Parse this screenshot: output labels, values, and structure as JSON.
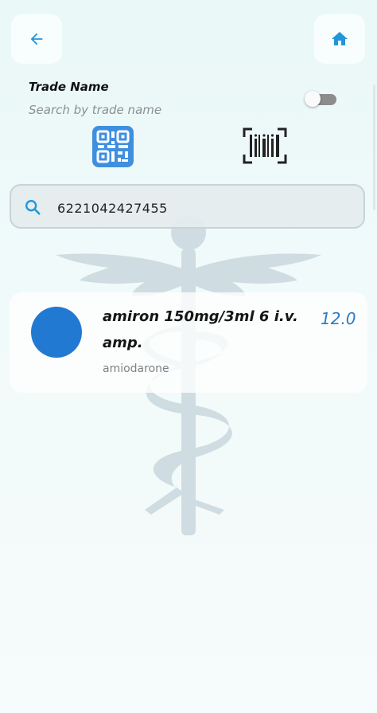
{
  "header": {
    "back_icon": "arrow-left-icon",
    "home_icon": "home-icon",
    "accent_color": "#2196d8"
  },
  "filter": {
    "title": "Trade Name",
    "subtitle": "Search by trade name",
    "toggle_on": false
  },
  "scan": {
    "qr_icon": "qr-code-icon",
    "barcode_icon": "barcode-scan-icon"
  },
  "search": {
    "icon": "search-icon",
    "value": "6221042427455"
  },
  "results": [
    {
      "name": "amiron 150mg/3ml 6 i.v. amp.",
      "generic": "amiodarone",
      "price": "12.0",
      "avatar_color": "#2279d2"
    }
  ]
}
